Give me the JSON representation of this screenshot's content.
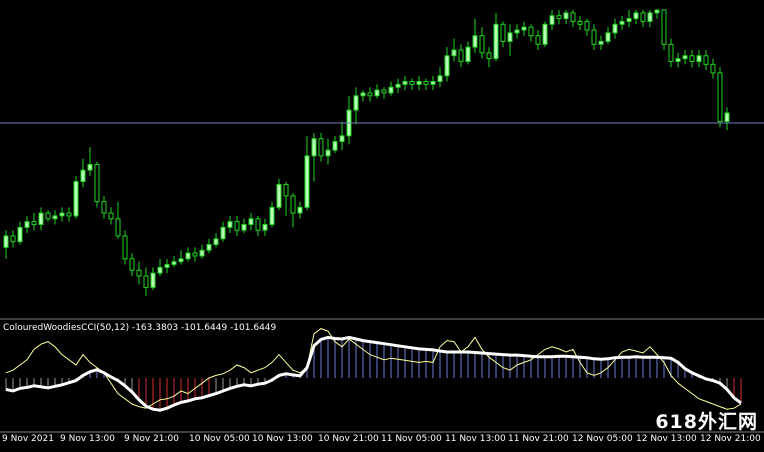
{
  "colors": {
    "background": "#000000",
    "bull": "#b8ffb8",
    "bear": "#000000",
    "wick": "#1fd41f",
    "priceLine": "#6f7fb8",
    "cciPositive": "#6c7bd8",
    "cciNegative": "#d83030",
    "cciNeutral": "#9a9a9a",
    "cciLine": "#ffffff",
    "turboLine": "#ffff99",
    "separator": "#808080"
  },
  "indicator": {
    "label": "ColouredWoodiesCCI(50,12) -163.3803 -101.6449 -101.6449"
  },
  "watermark": "618外汇网",
  "time_axis": [
    "9 Nov 2021",
    "9 Nov 13:00",
    "9 Nov 21:00",
    "10 Nov 05:00",
    "10 Nov 13:00",
    "10 Nov 21:00",
    "11 Nov 05:00",
    "11 Nov 13:00",
    "11 Nov 21:00",
    "12 Nov 05:00",
    "12 Nov 13:00",
    "12 Nov 21:00"
  ],
  "chart_data": {
    "type": "candlestick",
    "price_line_level": 0.605,
    "candles": [
      [
        0.17,
        0.21,
        0.13,
        0.23
      ],
      [
        0.21,
        0.19,
        0.17,
        0.23
      ],
      [
        0.19,
        0.24,
        0.18,
        0.26
      ],
      [
        0.24,
        0.26,
        0.22,
        0.28
      ],
      [
        0.26,
        0.25,
        0.23,
        0.29
      ],
      [
        0.25,
        0.29,
        0.23,
        0.31
      ],
      [
        0.29,
        0.27,
        0.26,
        0.3
      ],
      [
        0.27,
        0.28,
        0.25,
        0.3
      ],
      [
        0.28,
        0.29,
        0.26,
        0.31
      ],
      [
        0.29,
        0.28,
        0.26,
        0.31
      ],
      [
        0.28,
        0.4,
        0.27,
        0.42
      ],
      [
        0.4,
        0.44,
        0.38,
        0.48
      ],
      [
        0.44,
        0.46,
        0.42,
        0.52
      ],
      [
        0.46,
        0.33,
        0.31,
        0.47
      ],
      [
        0.33,
        0.29,
        0.27,
        0.35
      ],
      [
        0.29,
        0.27,
        0.25,
        0.31
      ],
      [
        0.27,
        0.21,
        0.2,
        0.33
      ],
      [
        0.21,
        0.13,
        0.11,
        0.23
      ],
      [
        0.13,
        0.09,
        0.07,
        0.15
      ],
      [
        0.09,
        0.07,
        0.04,
        0.12
      ],
      [
        0.07,
        0.03,
        0.0,
        0.1
      ],
      [
        0.03,
        0.08,
        0.02,
        0.1
      ],
      [
        0.08,
        0.1,
        0.07,
        0.13
      ],
      [
        0.1,
        0.11,
        0.08,
        0.13
      ],
      [
        0.11,
        0.12,
        0.1,
        0.14
      ],
      [
        0.12,
        0.13,
        0.11,
        0.16
      ],
      [
        0.13,
        0.15,
        0.12,
        0.17
      ],
      [
        0.15,
        0.14,
        0.12,
        0.17
      ],
      [
        0.14,
        0.16,
        0.13,
        0.18
      ],
      [
        0.16,
        0.18,
        0.15,
        0.2
      ],
      [
        0.18,
        0.2,
        0.17,
        0.22
      ],
      [
        0.2,
        0.24,
        0.19,
        0.26
      ],
      [
        0.24,
        0.26,
        0.22,
        0.28
      ],
      [
        0.26,
        0.23,
        0.21,
        0.28
      ],
      [
        0.23,
        0.25,
        0.22,
        0.27
      ],
      [
        0.25,
        0.27,
        0.23,
        0.29
      ],
      [
        0.27,
        0.23,
        0.21,
        0.28
      ],
      [
        0.23,
        0.25,
        0.21,
        0.27
      ],
      [
        0.25,
        0.31,
        0.24,
        0.33
      ],
      [
        0.31,
        0.39,
        0.3,
        0.41
      ],
      [
        0.39,
        0.35,
        0.28,
        0.4
      ],
      [
        0.35,
        0.29,
        0.24,
        0.36
      ],
      [
        0.29,
        0.31,
        0.27,
        0.33
      ],
      [
        0.31,
        0.49,
        0.3,
        0.56
      ],
      [
        0.49,
        0.55,
        0.4,
        0.57
      ],
      [
        0.55,
        0.49,
        0.47,
        0.57
      ],
      [
        0.49,
        0.51,
        0.46,
        0.55
      ],
      [
        0.51,
        0.54,
        0.5,
        0.56
      ],
      [
        0.54,
        0.56,
        0.51,
        0.61
      ],
      [
        0.56,
        0.65,
        0.53,
        0.7
      ],
      [
        0.65,
        0.7,
        0.6,
        0.73
      ],
      [
        0.7,
        0.71,
        0.68,
        0.72
      ],
      [
        0.71,
        0.7,
        0.68,
        0.73
      ],
      [
        0.7,
        0.72,
        0.69,
        0.74
      ],
      [
        0.72,
        0.71,
        0.69,
        0.73
      ],
      [
        0.71,
        0.73,
        0.7,
        0.75
      ],
      [
        0.73,
        0.74,
        0.71,
        0.76
      ],
      [
        0.74,
        0.75,
        0.72,
        0.77
      ],
      [
        0.75,
        0.74,
        0.72,
        0.76
      ],
      [
        0.74,
        0.75,
        0.72,
        0.77
      ],
      [
        0.75,
        0.74,
        0.72,
        0.76
      ],
      [
        0.74,
        0.75,
        0.72,
        0.77
      ],
      [
        0.75,
        0.77,
        0.73,
        0.8
      ],
      [
        0.77,
        0.84,
        0.75,
        0.87
      ],
      [
        0.84,
        0.86,
        0.82,
        0.9
      ],
      [
        0.86,
        0.82,
        0.8,
        0.88
      ],
      [
        0.82,
        0.87,
        0.81,
        0.89
      ],
      [
        0.87,
        0.91,
        0.85,
        0.97
      ],
      [
        0.91,
        0.85,
        0.83,
        0.94
      ],
      [
        0.85,
        0.83,
        0.8,
        0.87
      ],
      [
        0.83,
        0.95,
        0.82,
        0.99
      ],
      [
        0.95,
        0.89,
        0.87,
        0.96
      ],
      [
        0.89,
        0.92,
        0.84,
        0.95
      ],
      [
        0.92,
        0.93,
        0.9,
        0.95
      ],
      [
        0.93,
        0.94,
        0.91,
        0.96
      ],
      [
        0.94,
        0.91,
        0.89,
        0.95
      ],
      [
        0.91,
        0.88,
        0.86,
        0.93
      ],
      [
        0.88,
        0.95,
        0.87,
        0.96
      ],
      [
        0.95,
        0.98,
        0.93,
        1.0
      ],
      [
        0.98,
        0.97,
        0.95,
        1.0
      ],
      [
        0.97,
        0.99,
        0.95,
        1.0
      ],
      [
        0.99,
        0.96,
        0.94,
        1.0
      ],
      [
        0.96,
        0.95,
        0.93,
        0.98
      ],
      [
        0.96,
        0.93,
        0.91,
        0.97
      ],
      [
        0.93,
        0.88,
        0.86,
        0.95
      ],
      [
        0.88,
        0.89,
        0.86,
        0.91
      ],
      [
        0.89,
        0.92,
        0.88,
        0.94
      ],
      [
        0.92,
        0.95,
        0.9,
        0.97
      ],
      [
        0.95,
        0.96,
        0.93,
        0.98
      ],
      [
        0.96,
        0.97,
        0.94,
        1.0
      ],
      [
        0.97,
        0.99,
        0.95,
        1.0
      ],
      [
        0.99,
        0.96,
        0.94,
        1.0
      ],
      [
        0.96,
        0.99,
        0.94,
        1.0
      ],
      [
        0.99,
        1.0,
        0.97,
        1.0
      ],
      [
        1.0,
        0.88,
        0.86,
        1.0
      ],
      [
        0.88,
        0.82,
        0.8,
        0.9
      ],
      [
        0.82,
        0.83,
        0.8,
        0.85
      ],
      [
        0.83,
        0.84,
        0.81,
        0.86
      ],
      [
        0.84,
        0.82,
        0.8,
        0.86
      ],
      [
        0.82,
        0.84,
        0.8,
        0.86
      ],
      [
        0.84,
        0.81,
        0.79,
        0.86
      ],
      [
        0.81,
        0.78,
        0.76,
        0.83
      ],
      [
        0.78,
        0.61,
        0.59,
        0.8
      ],
      [
        0.61,
        0.64,
        0.58,
        0.66
      ]
    ],
    "cci": [
      -0.22,
      -0.25,
      -0.2,
      -0.18,
      -0.15,
      -0.17,
      -0.19,
      -0.16,
      -0.13,
      -0.09,
      -0.05,
      0.05,
      0.12,
      0.16,
      0.1,
      0.02,
      -0.05,
      -0.15,
      -0.27,
      -0.42,
      -0.54,
      -0.6,
      -0.62,
      -0.58,
      -0.52,
      -0.47,
      -0.44,
      -0.4,
      -0.38,
      -0.34,
      -0.3,
      -0.25,
      -0.2,
      -0.16,
      -0.13,
      -0.15,
      -0.12,
      -0.1,
      -0.04,
      0.05,
      0.08,
      0.06,
      0.04,
      0.2,
      0.62,
      0.74,
      0.78,
      0.76,
      0.75,
      0.78,
      0.75,
      0.72,
      0.7,
      0.68,
      0.66,
      0.64,
      0.62,
      0.6,
      0.58,
      0.56,
      0.55,
      0.54,
      0.52,
      0.5,
      0.5,
      0.5,
      0.5,
      0.49,
      0.48,
      0.47,
      0.46,
      0.45,
      0.44,
      0.44,
      0.43,
      0.42,
      0.41,
      0.41,
      0.41,
      0.42,
      0.42,
      0.41,
      0.4,
      0.39,
      0.37,
      0.36,
      0.37,
      0.39,
      0.4,
      0.4,
      0.41,
      0.4,
      0.4,
      0.4,
      0.39,
      0.38,
      0.3,
      0.18,
      0.1,
      0.04,
      -0.02,
      -0.05,
      -0.1,
      -0.22,
      -0.38,
      -0.48
    ],
    "turbo": [
      0.1,
      0.15,
      0.25,
      0.35,
      0.55,
      0.65,
      0.7,
      0.6,
      0.45,
      0.35,
      0.25,
      0.45,
      0.3,
      0.2,
      0.1,
      -0.1,
      -0.3,
      -0.4,
      -0.5,
      -0.55,
      -0.58,
      -0.5,
      -0.42,
      -0.4,
      -0.35,
      -0.25,
      -0.3,
      -0.2,
      -0.1,
      0.0,
      0.05,
      0.08,
      0.15,
      0.25,
      0.2,
      0.1,
      0.15,
      0.2,
      0.3,
      0.45,
      0.3,
      0.15,
      0.1,
      0.2,
      0.85,
      0.95,
      0.9,
      0.7,
      0.6,
      0.75,
      0.65,
      0.55,
      0.45,
      0.4,
      0.35,
      0.38,
      0.36,
      0.34,
      0.32,
      0.3,
      0.32,
      0.3,
      0.6,
      0.72,
      0.7,
      0.5,
      0.6,
      0.78,
      0.55,
      0.4,
      0.3,
      0.2,
      0.15,
      0.25,
      0.3,
      0.35,
      0.45,
      0.55,
      0.6,
      0.56,
      0.5,
      0.55,
      0.3,
      0.1,
      0.05,
      0.1,
      0.2,
      0.35,
      0.5,
      0.55,
      0.52,
      0.48,
      0.6,
      0.45,
      0.3,
      0.05,
      -0.1,
      -0.2,
      -0.3,
      -0.4,
      -0.45,
      -0.5,
      -0.55,
      -0.6,
      -0.58,
      -0.5
    ],
    "cci_range": [
      -1,
      1
    ]
  }
}
